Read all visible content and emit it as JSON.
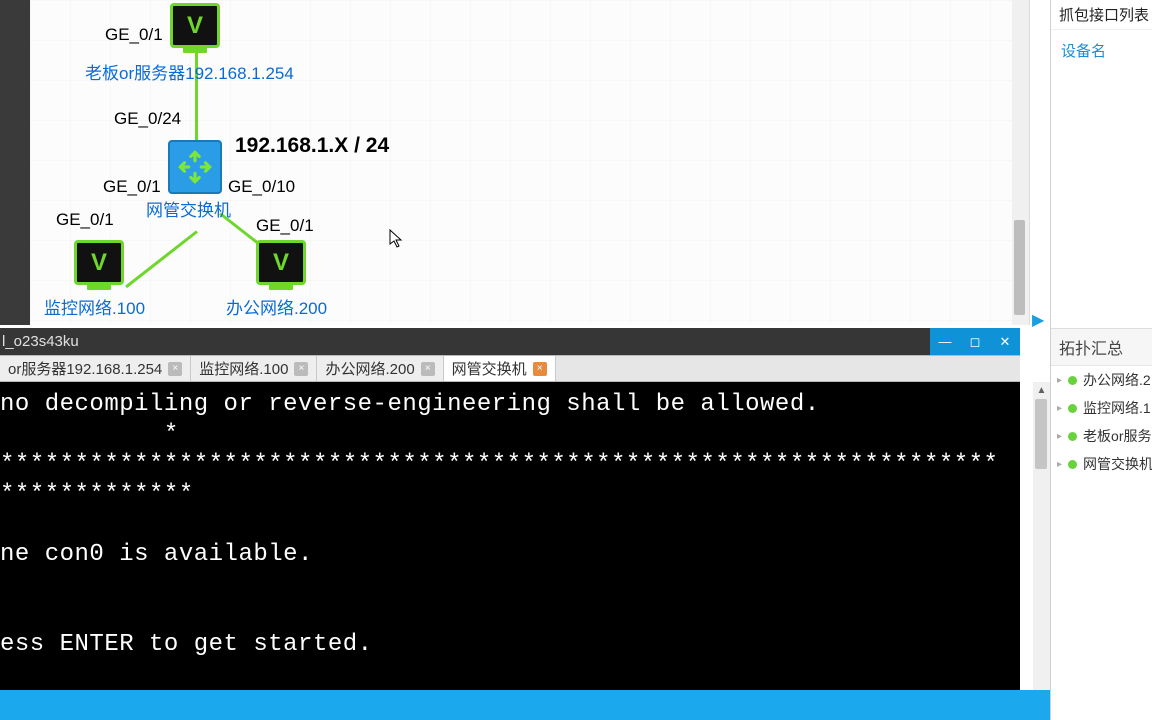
{
  "canvas": {
    "server": {
      "label": "老板or服务器192.168.1.254",
      "port": "GE_0/1"
    },
    "switch": {
      "label": "网管交换机",
      "port_up": "GE_0/24",
      "port_left": "GE_0/1",
      "port_right": "GE_0/10"
    },
    "subnet": "192.168.1.X / 24",
    "monitor": {
      "label": "监控网络.100",
      "port": "GE_0/1"
    },
    "office": {
      "label": "办公网络.200",
      "port": "GE_0/1"
    }
  },
  "terminal": {
    "title": "l_o23s43ku",
    "tabs": [
      {
        "label": "or服务器192.168.1.254",
        "active": false
      },
      {
        "label": "监控网络.100",
        "active": false
      },
      {
        "label": "办公网络.200",
        "active": false
      },
      {
        "label": "网管交换机",
        "active": true
      }
    ],
    "lines": "no decompiling or reverse-engineering shall be allowed.\n           *\n*******************************************************************\n*************\n\nne con0 is available.\n\n\ness ENTER to get started."
  },
  "side": {
    "capture_header": "抓包接口列表",
    "col_head": "设备名",
    "summary_header": "拓扑汇总",
    "items": [
      "办公网络.2",
      "监控网络.1",
      "老板or服务",
      "网管交换机"
    ]
  }
}
